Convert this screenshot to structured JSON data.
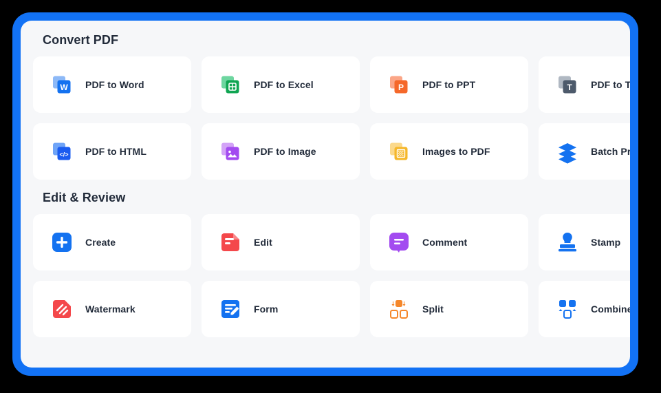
{
  "theme": {
    "frame_color": "#1272f5",
    "panel_bg": "#f6f7f9",
    "card_bg": "#ffffff",
    "text_color": "#222b3a",
    "page_bg": "#000000"
  },
  "sections": [
    {
      "title": "Convert PDF",
      "tools": [
        {
          "label": "PDF to Word",
          "icon": "pdf-to-word-icon",
          "color": "#1472f0",
          "accent": "#8db9f7"
        },
        {
          "label": "PDF to Excel",
          "icon": "pdf-to-excel-icon",
          "color": "#10a552",
          "accent": "#6ed6a0"
        },
        {
          "label": "PDF to PPT",
          "icon": "pdf-to-ppt-icon",
          "color": "#f5682a",
          "accent": "#fba687"
        },
        {
          "label": "PDF to TXT",
          "icon": "pdf-to-txt-icon",
          "color": "#4d5a6b",
          "accent": "#b0b8c2"
        },
        {
          "label": "PDF to HTML",
          "icon": "pdf-to-html-icon",
          "color": "#1a5cf0",
          "accent": "#6fa4f7"
        },
        {
          "label": "PDF to Image",
          "icon": "pdf-to-image-icon",
          "color": "#a34bf0",
          "accent": "#d3a3f7"
        },
        {
          "label": "Images to PDF",
          "icon": "images-to-pdf-icon",
          "color": "#f5b72a",
          "accent": "#fbd98c"
        },
        {
          "label": "Batch Process",
          "icon": "batch-process-icon",
          "color": "#1472f0",
          "accent": "#1472f0"
        }
      ]
    },
    {
      "title": "Edit & Review",
      "tools": [
        {
          "label": "Create",
          "icon": "create-icon",
          "color": "#1472f0",
          "accent": "#ffffff"
        },
        {
          "label": "Edit",
          "icon": "edit-icon",
          "color": "#f4484b",
          "accent": "#f9888a"
        },
        {
          "label": "Comment",
          "icon": "comment-icon",
          "color": "#a34bf0",
          "accent": "#ffffff"
        },
        {
          "label": "Stamp",
          "icon": "stamp-icon",
          "color": "#1472f0",
          "accent": "#1472f0"
        },
        {
          "label": "Watermark",
          "icon": "watermark-icon",
          "color": "#f4484b",
          "accent": "#ffffff"
        },
        {
          "label": "Form",
          "icon": "form-icon",
          "color": "#1472f0",
          "accent": "#ffffff"
        },
        {
          "label": "Split",
          "icon": "split-icon",
          "color": "#f5872a",
          "accent": "#f5872a"
        },
        {
          "label": "Combine",
          "icon": "combine-icon",
          "color": "#1472f0",
          "accent": "#1472f0"
        }
      ]
    }
  ]
}
